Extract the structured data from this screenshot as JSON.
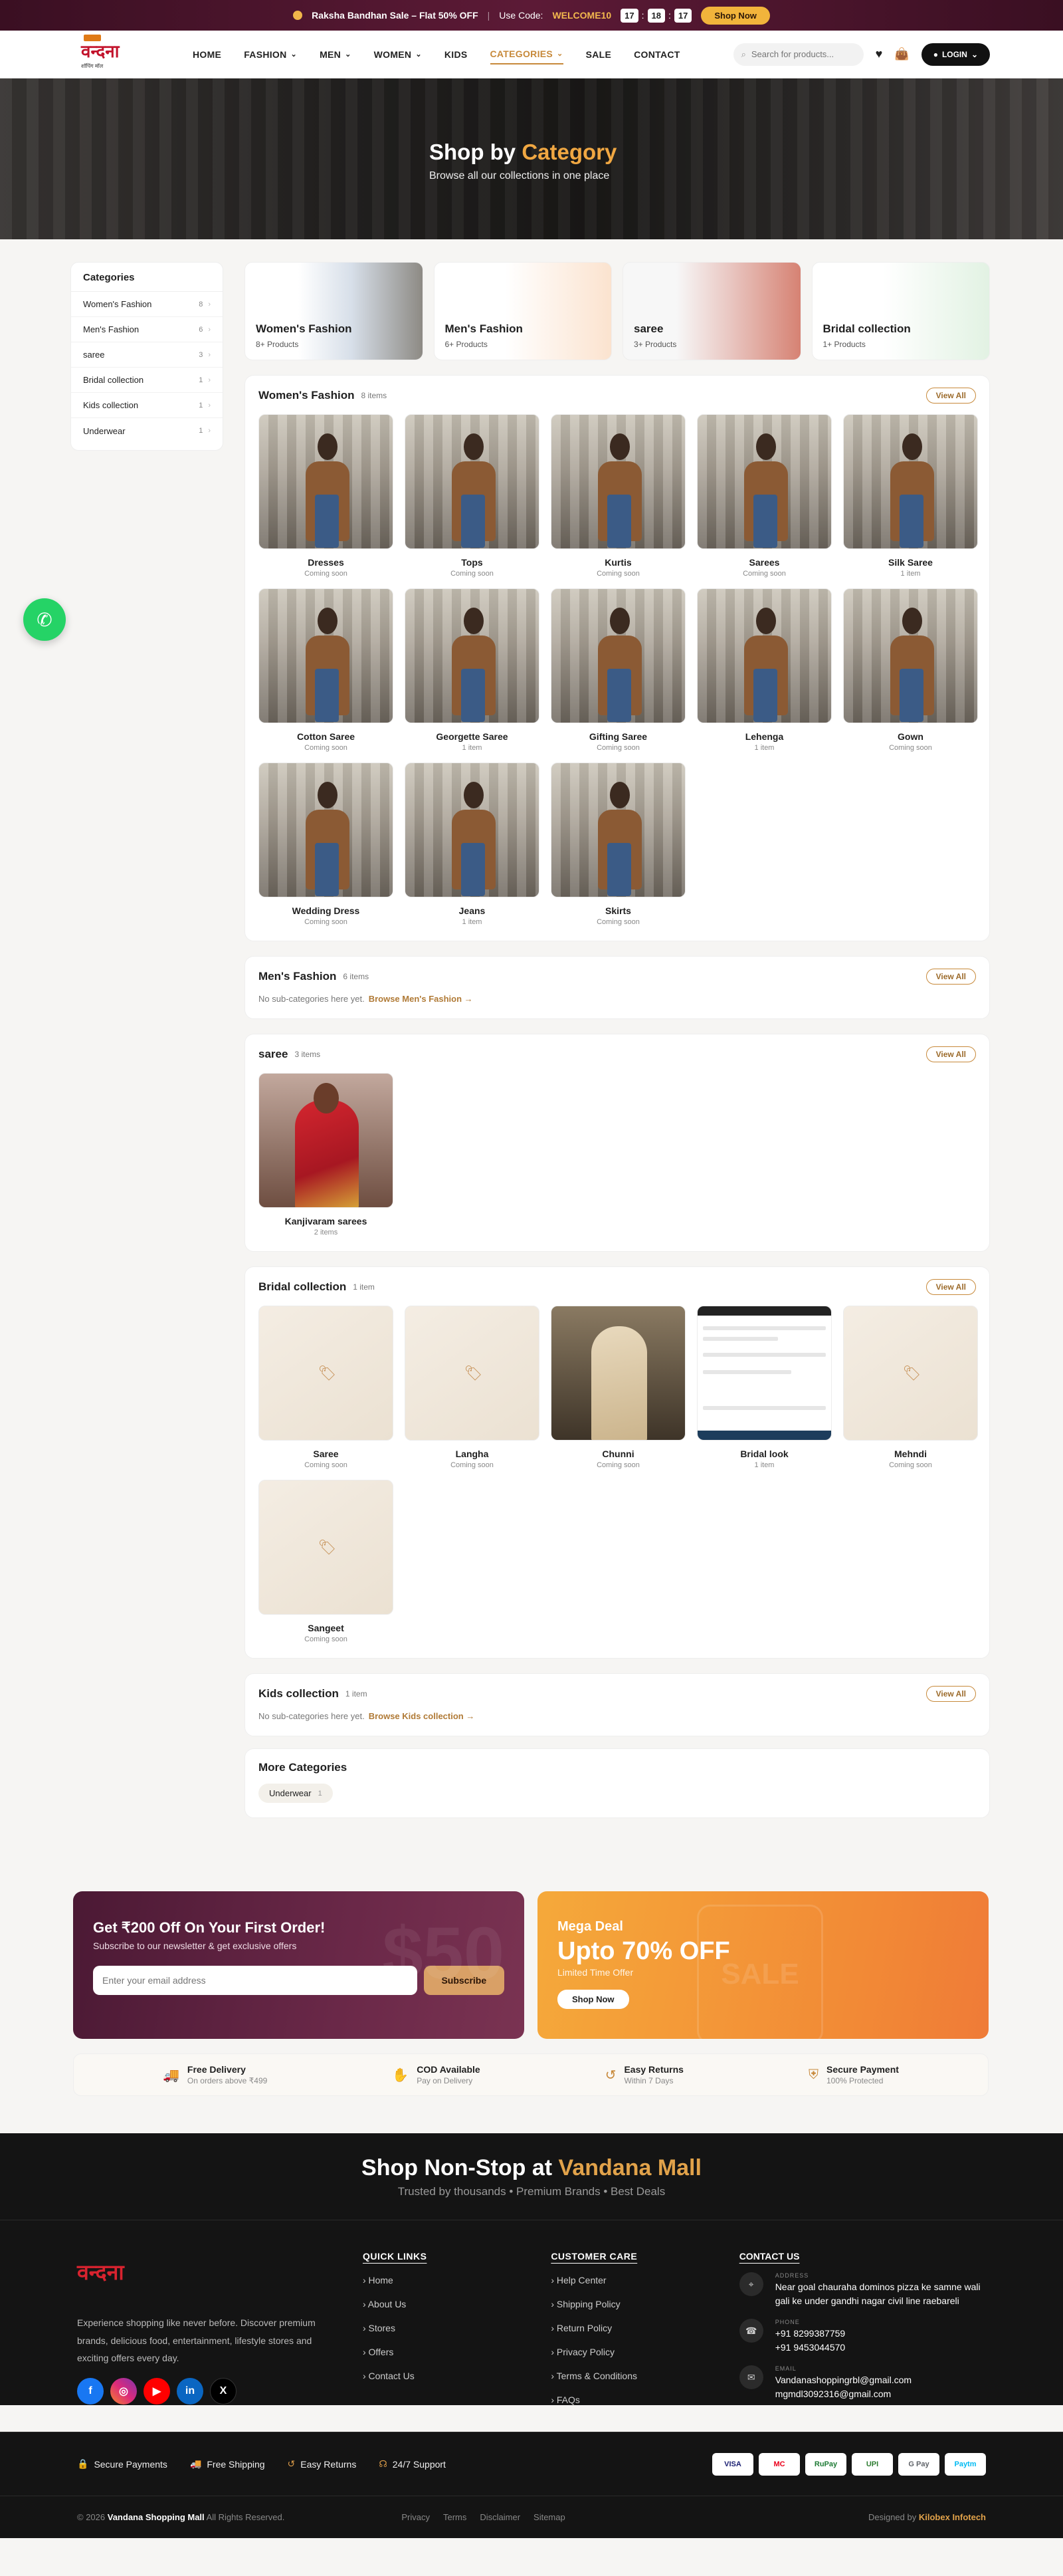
{
  "topbar": {
    "sale": "Raksha Bandhan Sale – Flat 50% OFF",
    "code_prefix": "Use Code:",
    "code": "WELCOME10",
    "countdown": [
      "17",
      "18",
      "17"
    ],
    "shop_now": "Shop Now"
  },
  "nav": {
    "logo_text": "वन्दना",
    "logo_sub": "शॉपिंग मॉल",
    "menu": [
      {
        "label": "HOME"
      },
      {
        "label": "FASHION"
      },
      {
        "label": "MEN"
      },
      {
        "label": "WOMEN"
      },
      {
        "label": "KIDS"
      },
      {
        "label": "CATEGORIES"
      },
      {
        "label": "SALE"
      },
      {
        "label": "CONTACT"
      }
    ],
    "search_placeholder": "Search for products...",
    "login": "LOGIN"
  },
  "hero": {
    "title_a": "Shop by",
    "title_b": "Category",
    "subtitle": "Browse all our collections in one place"
  },
  "sidebar": {
    "title": "Categories",
    "items": [
      {
        "label": "Women's Fashion",
        "count": "8"
      },
      {
        "label": "Men's Fashion",
        "count": "6"
      },
      {
        "label": "saree",
        "count": "3"
      },
      {
        "label": "Bridal collection",
        "count": "1"
      },
      {
        "label": "Kids collection",
        "count": "1"
      },
      {
        "label": "Underwear",
        "count": "1"
      }
    ]
  },
  "tiles": [
    {
      "title": "Women's Fashion",
      "sub": "8+ Products"
    },
    {
      "title": "Men's Fashion",
      "sub": "6+ Products"
    },
    {
      "title": "saree",
      "sub": "3+ Products"
    },
    {
      "title": "Bridal collection",
      "sub": "1+ Products"
    }
  ],
  "view_all": "View All",
  "womens": {
    "title": "Women's Fashion",
    "items": "8 items",
    "cards": [
      {
        "name": "Dresses",
        "status": "Coming soon"
      },
      {
        "name": "Tops",
        "status": "Coming soon"
      },
      {
        "name": "Kurtis",
        "status": "Coming soon"
      },
      {
        "name": "Sarees",
        "status": "Coming soon"
      },
      {
        "name": "Silk Saree",
        "status": "1 item"
      },
      {
        "name": "Cotton Saree",
        "status": "Coming soon"
      },
      {
        "name": "Georgette Saree",
        "status": "1 item"
      },
      {
        "name": "Gifting Saree",
        "status": "Coming soon"
      },
      {
        "name": "Lehenga",
        "status": "1 item"
      },
      {
        "name": "Gown",
        "status": "Coming soon"
      },
      {
        "name": "Wedding Dress",
        "status": "Coming soon"
      },
      {
        "name": "Jeans",
        "status": "1 item"
      },
      {
        "name": "Skirts",
        "status": "Coming soon"
      }
    ]
  },
  "mens": {
    "title": "Men's Fashion",
    "items": "6 items",
    "nosub": "No sub-categories here yet.",
    "browse": "Browse Men's Fashion →"
  },
  "saree": {
    "title": "saree",
    "items": "3 items",
    "cards": [
      {
        "name": "Kanjivaram sarees",
        "status": "2 items"
      }
    ]
  },
  "bridal": {
    "title": "Bridal collection",
    "items": "1 item",
    "cards": [
      {
        "name": "Saree",
        "status": "Coming soon"
      },
      {
        "name": "Langha",
        "status": "Coming soon"
      },
      {
        "name": "Chunni",
        "status": "Coming soon"
      },
      {
        "name": "Bridal look",
        "status": "1 item"
      },
      {
        "name": "Mehndi",
        "status": "Coming soon"
      },
      {
        "name": "Sangeet",
        "status": "Coming soon"
      }
    ]
  },
  "kids": {
    "title": "Kids collection",
    "items": "1 item",
    "nosub": "No sub-categories here yet.",
    "browse": "Browse Kids collection →"
  },
  "more": {
    "title": "More Categories",
    "chip": "Underwear",
    "chip_count": "1"
  },
  "promo1": {
    "title": "Get ₹200 Off On Your First Order!",
    "sub": "Subscribe to our newsletter & get exclusive offers",
    "placeholder": "Enter your email address",
    "button": "Subscribe",
    "watermark": "$50"
  },
  "promo2": {
    "label": "Mega Deal",
    "big": "Upto 70% OFF",
    "sub": "Limited Time Offer",
    "button": "Shop Now",
    "watermark": "SALE"
  },
  "features": [
    {
      "title": "Free Delivery",
      "sub": "On orders above ₹499"
    },
    {
      "title": "COD Available",
      "sub": "Pay on Delivery"
    },
    {
      "title": "Easy Returns",
      "sub": "Within 7 Days"
    },
    {
      "title": "Secure Payment",
      "sub": "100% Protected"
    }
  ],
  "banner": {
    "title_a": "Shop Non-Stop at",
    "title_b": "Vandana Mall",
    "sub": "Trusted by thousands • Premium Brands • Best Deals"
  },
  "footer": {
    "logo": "वन्दना",
    "desc": "Experience shopping like never before. Discover premium brands, delicious food, entertainment, lifestyle stores and exciting offers every day.",
    "quick_title": "QUICK LINKS",
    "quick": [
      "Home",
      "About Us",
      "Stores",
      "Offers",
      "Contact Us"
    ],
    "care_title": "CUSTOMER CARE",
    "care": [
      "Help Center",
      "Shipping Policy",
      "Return Policy",
      "Privacy Policy",
      "Terms & Conditions",
      "FAQs"
    ],
    "contact_title": "CONTACT US",
    "address_label": "ADDRESS",
    "address": "Near goal chauraha dominos pizza ke samne wali gali ke under gandhi nagar civil line raebareli",
    "phone_label": "PHONE",
    "phone1": "+91 8299387759",
    "phone2": "+91 9453044570",
    "email_label": "EMAIL",
    "email1": "Vandanashoppingrbl@gmail.com",
    "email2": "mgmdl3092316@gmail.com"
  },
  "payrow": {
    "features": [
      "Secure Payments",
      "Free Shipping",
      "Easy Returns",
      "24/7 Support"
    ],
    "cards": [
      "VISA",
      "MC",
      "RuPay",
      "UPI",
      "G Pay",
      "Paytm"
    ]
  },
  "bottom": {
    "copy_prefix": "© 2026",
    "brand": "Vandana Shopping Mall",
    "copy_suffix": "All Rights Reserved.",
    "links": [
      "Privacy",
      "Terms",
      "Disclaimer",
      "Sitemap"
    ],
    "designed_prefix": "Designed by",
    "designer": "Kilobex Infotech"
  }
}
